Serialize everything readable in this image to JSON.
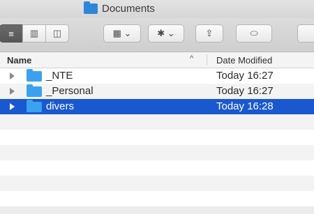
{
  "window": {
    "title": "Documents",
    "folder_icon": "folder-icon"
  },
  "toolbar": {
    "view_icons": [
      "list-view-icon",
      "column-view-icon",
      "gallery-view-icon"
    ],
    "arrange_label": "▦ ⌄",
    "action_label": "✱ ⌄",
    "share_label": "⇪",
    "tag_label": "⬭"
  },
  "columns": {
    "name": "Name",
    "sort_indicator": "^",
    "date_modified": "Date Modified"
  },
  "rows": [
    {
      "name": "_NTE",
      "date": "Today 16:27",
      "selected": false
    },
    {
      "name": "_Personal",
      "date": "Today 16:27",
      "selected": false
    },
    {
      "name": "divers",
      "date": "Today 16:28",
      "selected": true
    }
  ],
  "colors": {
    "selection": "#1a58d0",
    "folder": "#3aa2f0"
  }
}
